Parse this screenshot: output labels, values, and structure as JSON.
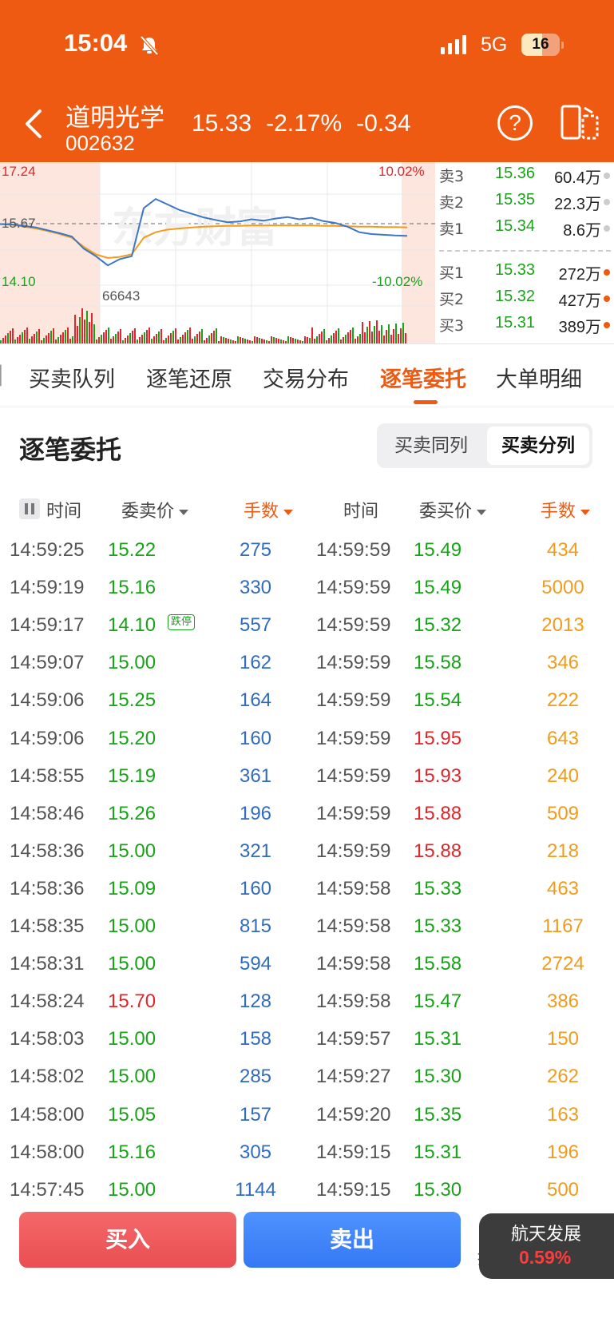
{
  "status_bar": {
    "time": "15:04",
    "network": "5G",
    "battery": "16"
  },
  "stock": {
    "name": "道明光学",
    "code": "002632",
    "price": "15.33",
    "change_pct": "-2.17%",
    "change": "-0.34"
  },
  "chart": {
    "high_label": "17.24",
    "mid_label": "15.67",
    "low_label": "14.10",
    "up_pct": "10.02%",
    "down_pct": "-10.02%",
    "volume_label": "66643",
    "watermark": "东方财富"
  },
  "chart_data": {
    "type": "line",
    "ylim": [
      14.1,
      17.24
    ],
    "reference": 15.67,
    "series": [
      {
        "name": "price",
        "values": [
          15.67,
          15.66,
          15.62,
          15.58,
          15.5,
          15.42,
          15.33,
          15.0,
          14.8,
          14.55,
          14.72,
          14.8,
          16.1,
          16.35,
          16.2,
          16.05,
          15.95,
          15.85,
          15.78,
          15.72,
          15.74,
          15.8,
          15.76,
          15.82,
          15.86,
          15.8,
          15.84,
          15.75,
          15.7,
          15.6,
          15.45,
          15.4,
          15.38,
          15.36,
          15.35
        ]
      },
      {
        "name": "avg",
        "values": [
          15.67,
          15.65,
          15.6,
          15.55,
          15.48,
          15.4,
          15.3,
          15.05,
          14.85,
          14.75,
          14.78,
          14.85,
          15.3,
          15.45,
          15.52,
          15.55,
          15.58,
          15.6,
          15.61,
          15.62,
          15.62,
          15.63,
          15.63,
          15.63,
          15.63,
          15.63,
          15.63,
          15.62,
          15.62,
          15.61,
          15.6,
          15.6,
          15.59,
          15.59,
          15.58
        ]
      }
    ]
  },
  "order_book": {
    "sell": [
      {
        "label": "卖3",
        "price": "15.36",
        "vol": "60.4万"
      },
      {
        "label": "卖2",
        "price": "15.35",
        "vol": "22.3万"
      },
      {
        "label": "卖1",
        "price": "15.34",
        "vol": "8.6万"
      }
    ],
    "buy": [
      {
        "label": "买1",
        "price": "15.33",
        "vol": "272万"
      },
      {
        "label": "买2",
        "price": "15.32",
        "vol": "427万"
      },
      {
        "label": "买3",
        "price": "15.31",
        "vol": "389万"
      }
    ]
  },
  "tabs": [
    "买卖队列",
    "逐笔还原",
    "交易分布",
    "逐笔委托",
    "大单明细"
  ],
  "section": {
    "title": "逐笔委托",
    "seg_a": "买卖同列",
    "seg_b": "买卖分列"
  },
  "headers": {
    "time1": "时间",
    "sell_price": "委卖价",
    "qty1": "手数",
    "time2": "时间",
    "buy_price": "委买价",
    "qty2": "手数"
  },
  "limit_down_tag": "跌停",
  "rows": [
    {
      "t1": "14:59:25",
      "p1": "15.22",
      "q1": "275",
      "t2": "14:59:59",
      "p2": "15.49",
      "q2": "434",
      "c1": "g",
      "c2": "g"
    },
    {
      "t1": "14:59:19",
      "p1": "15.16",
      "q1": "330",
      "t2": "14:59:59",
      "p2": "15.49",
      "q2": "5000",
      "c1": "g",
      "c2": "g"
    },
    {
      "t1": "14:59:17",
      "p1": "14.10",
      "q1": "557",
      "t2": "14:59:59",
      "p2": "15.32",
      "q2": "2013",
      "c1": "g",
      "c2": "g"
    },
    {
      "t1": "14:59:07",
      "p1": "15.00",
      "q1": "162",
      "t2": "14:59:59",
      "p2": "15.58",
      "q2": "346",
      "c1": "g",
      "c2": "g"
    },
    {
      "t1": "14:59:06",
      "p1": "15.25",
      "q1": "164",
      "t2": "14:59:59",
      "p2": "15.54",
      "q2": "222",
      "c1": "g",
      "c2": "g"
    },
    {
      "t1": "14:59:06",
      "p1": "15.20",
      "q1": "160",
      "t2": "14:59:59",
      "p2": "15.95",
      "q2": "643",
      "c1": "g",
      "c2": "r"
    },
    {
      "t1": "14:58:55",
      "p1": "15.19",
      "q1": "361",
      "t2": "14:59:59",
      "p2": "15.93",
      "q2": "240",
      "c1": "g",
      "c2": "r"
    },
    {
      "t1": "14:58:46",
      "p1": "15.26",
      "q1": "196",
      "t2": "14:59:59",
      "p2": "15.88",
      "q2": "509",
      "c1": "g",
      "c2": "r"
    },
    {
      "t1": "14:58:36",
      "p1": "15.00",
      "q1": "321",
      "t2": "14:59:59",
      "p2": "15.88",
      "q2": "218",
      "c1": "g",
      "c2": "r"
    },
    {
      "t1": "14:58:36",
      "p1": "15.09",
      "q1": "160",
      "t2": "14:59:58",
      "p2": "15.33",
      "q2": "463",
      "c1": "g",
      "c2": "g"
    },
    {
      "t1": "14:58:35",
      "p1": "15.00",
      "q1": "815",
      "t2": "14:59:58",
      "p2": "15.33",
      "q2": "1167",
      "c1": "g",
      "c2": "g"
    },
    {
      "t1": "14:58:31",
      "p1": "15.00",
      "q1": "594",
      "t2": "14:59:58",
      "p2": "15.58",
      "q2": "2724",
      "c1": "g",
      "c2": "g"
    },
    {
      "t1": "14:58:24",
      "p1": "15.70",
      "q1": "128",
      "t2": "14:59:58",
      "p2": "15.47",
      "q2": "386",
      "c1": "r",
      "c2": "g"
    },
    {
      "t1": "14:58:03",
      "p1": "15.00",
      "q1": "158",
      "t2": "14:59:57",
      "p2": "15.31",
      "q2": "150",
      "c1": "g",
      "c2": "g"
    },
    {
      "t1": "14:58:02",
      "p1": "15.00",
      "q1": "285",
      "t2": "14:59:27",
      "p2": "15.30",
      "q2": "262",
      "c1": "g",
      "c2": "g"
    },
    {
      "t1": "14:58:00",
      "p1": "15.05",
      "q1": "157",
      "t2": "14:59:20",
      "p2": "15.35",
      "q2": "163",
      "c1": "g",
      "c2": "g"
    },
    {
      "t1": "14:58:00",
      "p1": "15.16",
      "q1": "305",
      "t2": "14:59:15",
      "p2": "15.31",
      "q2": "196",
      "c1": "g",
      "c2": "g"
    },
    {
      "t1": "14:57:45",
      "p1": "15.00",
      "q1": "1144",
      "t2": "14:59:15",
      "p2": "15.30",
      "q2": "500",
      "c1": "g",
      "c2": "g"
    }
  ],
  "bottom": {
    "buy": "买入",
    "sell": "卖出",
    "more_a": "撤",
    "more_b": "持"
  },
  "float_card": {
    "name": "航天发展",
    "pct": "0.59%"
  },
  "colors": {
    "brand": "#ee5a12",
    "up": "#e0262a",
    "down": "#18a318",
    "qty_sell": "#2f6bc0",
    "qty_buy": "#f39b1b"
  }
}
